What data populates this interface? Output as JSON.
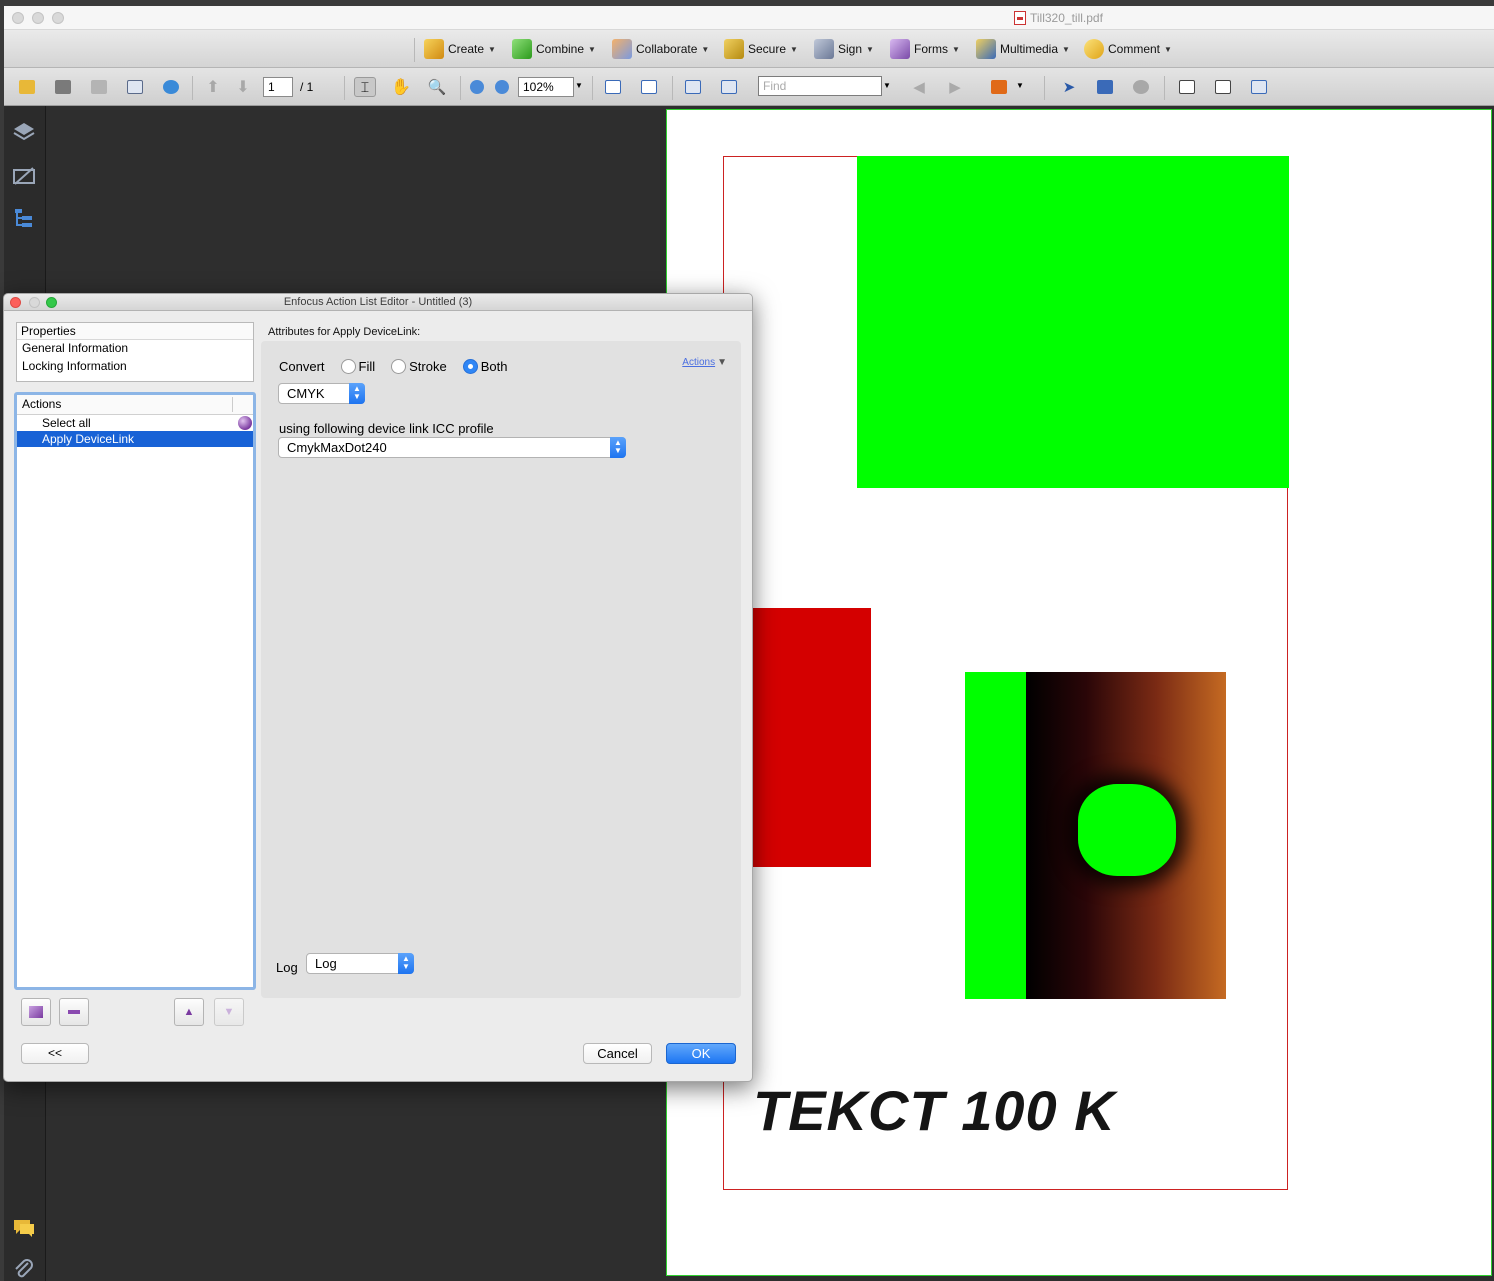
{
  "app": {
    "doc_title": "Till320_till.pdf"
  },
  "toolbar1": {
    "items": [
      {
        "label": "Create"
      },
      {
        "label": "Combine"
      },
      {
        "label": "Collaborate"
      },
      {
        "label": "Secure"
      },
      {
        "label": "Sign"
      },
      {
        "label": "Forms"
      },
      {
        "label": "Multimedia"
      },
      {
        "label": "Comment"
      }
    ]
  },
  "toolbar2": {
    "page_current": "1",
    "page_total": "/ 1",
    "zoom": "102%",
    "find_placeholder": "Find"
  },
  "document": {
    "page_text": "TEKCT 100 K",
    "colors": {
      "green": "#00ff00",
      "red": "#d40000",
      "trim": "#cc2222"
    }
  },
  "dialog": {
    "title": "Enfocus Action List Editor - Untitled (3)",
    "properties": {
      "header": "Properties",
      "items": [
        "General Information",
        "Locking Information"
      ]
    },
    "actions": {
      "header": "Actions",
      "items": [
        "Select all",
        "Apply DeviceLink"
      ],
      "selected": "Apply DeviceLink"
    },
    "attributes_label": "Attributes for Apply DeviceLink:",
    "convert": {
      "label": "Convert",
      "options": [
        "Fill",
        "Stroke",
        "Both"
      ],
      "selected": "Both"
    },
    "actions_link": "Actions",
    "colorspace": "CMYK",
    "icc_label": "using following device link ICC profile",
    "icc_profile": "CmykMaxDot240",
    "log_label": "Log",
    "log_value": "Log",
    "buttons": {
      "back": "<<",
      "cancel": "Cancel",
      "ok": "OK"
    }
  }
}
